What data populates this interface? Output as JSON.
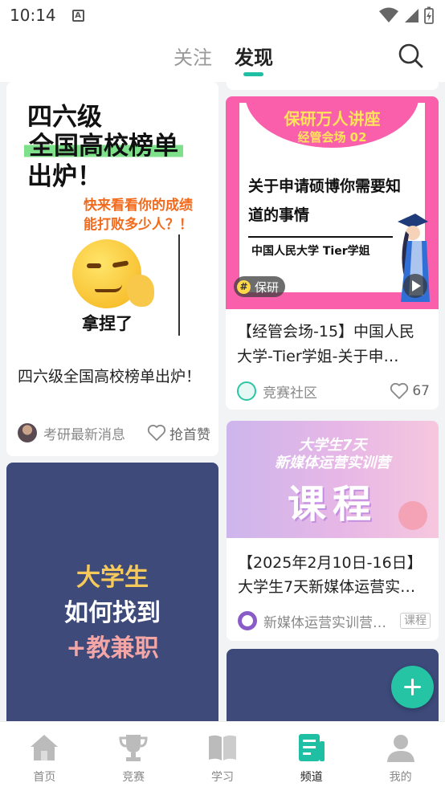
{
  "status_bar": {
    "time": "10:14",
    "notif_letter": "A"
  },
  "header": {
    "tabs": [
      {
        "label": "关注",
        "active": false
      },
      {
        "label": "发现",
        "active": true
      }
    ],
    "search_icon": "search-icon",
    "accent": "#1fbfa3"
  },
  "feed": {
    "cards": [
      {
        "image": {
          "line1": "四六级",
          "line2": "全国高校榜单",
          "line3": "出炉！",
          "orange1": "快来看看你的成绩",
          "orange2": "能打败多少人？！",
          "caption": "拿捏了"
        },
        "title": "四六级全国高校榜单出炉！",
        "author": "考研最新消息",
        "like_label": "抢首赞"
      },
      {
        "image": {
          "head1": "保研万人讲座",
          "head2": "经管会场 02",
          "big_line1": "关于申请硕博你需要知",
          "big_line2": "道的事情",
          "small": "中国人民大学 Tier学姐",
          "tag": "保研"
        },
        "title": "【经管会场-15】中国人民大学-Tier学姐-关于申…",
        "author": "竞赛社区",
        "likes": "67"
      },
      {
        "image": {
          "line1": "大学生",
          "line2": "如何找到",
          "line3": "+教兼职"
        }
      },
      {
        "image": {
          "t1": "大学生7天",
          "t2": "新媒体运营实训营",
          "big": "课程"
        },
        "title": "【2025年2月10日-16日】大学生7天新媒体运营实…",
        "author": "新媒体运营实训营…",
        "tag": "课程"
      }
    ]
  },
  "fab": {
    "icon": "plus-icon"
  },
  "bottom_nav": [
    {
      "label": "首页",
      "icon": "home-icon",
      "active": false
    },
    {
      "label": "竞赛",
      "icon": "trophy-icon",
      "active": false
    },
    {
      "label": "学习",
      "icon": "book-icon",
      "active": false
    },
    {
      "label": "频道",
      "icon": "channel-icon",
      "active": true
    },
    {
      "label": "我的",
      "icon": "profile-icon",
      "active": false
    }
  ]
}
